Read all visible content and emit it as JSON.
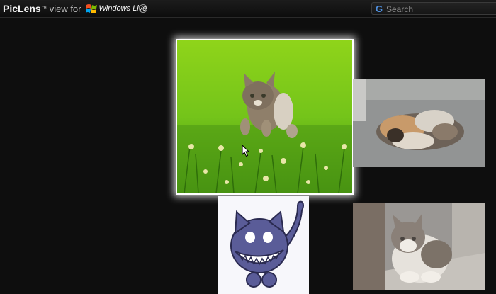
{
  "header": {
    "brand_name": "PicLens",
    "brand_tm": "™",
    "brand_view_for": "view for",
    "windows_live_label": "Windows Live",
    "help_icon": "help-circle-icon"
  },
  "search": {
    "logo_letter": "G",
    "placeholder": "Search",
    "value": ""
  },
  "gallery": {
    "selected_index": 0,
    "items": [
      {
        "subject": "kitten leaping through green grass",
        "selected": true
      },
      {
        "subject": "kittens curled up sleeping"
      },
      {
        "subject": "cartoon grinning purple cat"
      },
      {
        "subject": "grey and white cat crouching"
      }
    ]
  },
  "colors": {
    "background": "#0e0e0e",
    "selection_glow": "#ffffff",
    "search_logo": "#4f90e0"
  }
}
